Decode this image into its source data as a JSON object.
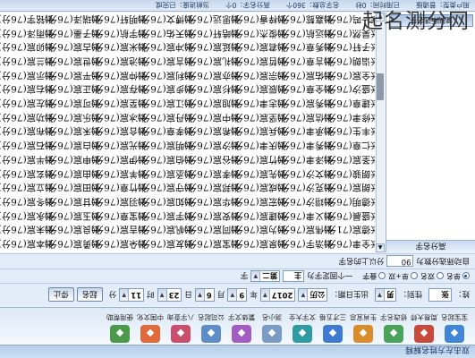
{
  "watermark": "起名测分网",
  "app": {
    "title": "双击左方姓名解释"
  },
  "toolbar": [
    {
      "label": "宝宝起名",
      "icon": "baby-icon",
      "color": "#3f86d6"
    },
    {
      "label": "周易大师",
      "icon": "bagua-icon",
      "color": "#c84a3a"
    },
    {
      "label": "修改名字",
      "icon": "edit-icon",
      "color": "#4aa35a"
    },
    {
      "label": "生肖宜忌",
      "icon": "zodiac-icon",
      "color": "#d98d2a"
    },
    {
      "label": "三才五格",
      "icon": "grid-icon",
      "color": "#3c7bd0"
    },
    {
      "label": "文字大全",
      "icon": "book-icon",
      "color": "#2f9ca3"
    },
    {
      "label": "测小名",
      "icon": "bird-icon",
      "color": "#7a9bc4"
    },
    {
      "label": "繁体文字",
      "icon": "text-icon",
      "color": "#a25cc2"
    },
    {
      "label": "公司起名",
      "icon": "building-icon",
      "color": "#5f8dc9"
    },
    {
      "label": "八字查询",
      "icon": "calendar-icon",
      "color": "#c94f6d"
    },
    {
      "label": "中国文化",
      "icon": "lantern-icon",
      "color": "#e06a3b"
    },
    {
      "label": "使用帮助",
      "icon": "help-icon",
      "color": "#4a9a4a"
    }
  ],
  "form": {
    "surname_label": "姓：",
    "surname_value": "张",
    "gender_label": "性别：",
    "gender_value": "男",
    "birth_label": "出生日期：",
    "calendar_value": "公历",
    "year_value": "2017",
    "year_unit": "年",
    "month_value": "9",
    "month_unit": "月",
    "day_value": "6",
    "day_unit": "日",
    "hour_value": "23",
    "hour_unit": "时",
    "minute_value": "11",
    "minute_unit": "分",
    "start_button": "起名",
    "stop_button": "停止"
  },
  "options": {
    "radios": [
      "单名",
      "双名",
      "单+双",
      "叠字"
    ],
    "selected_index": 0,
    "fixed_label": "一个固定字为",
    "fixed_value": "主",
    "position_value": "第二",
    "position_unit": "字",
    "score_label": "自动筛选分数为",
    "score_value": "90",
    "score_unit": "分以上的名字"
  },
  "sidebar": {
    "header": "高分名字",
    "footer_button": "复制所选名字"
  },
  "names": [
    [
      "张全聿(76分)",
      "张德宸(71分)",
      "张盛晨(76分)",
      "张德明(76分)",
      "张朗宸(76分)",
      "张朗骏(76分)",
      "张圣宸(76分)",
      "张仁章(76分)",
      "张丰生(76分)",
      "张修聿(76分)",
      "张建章(76分)",
      "张盛汐(76分)",
      "张全宸(76分)",
      "张诣朗(76分)",
      "张子轩(76分)",
      "张昊然(76分)",
      "张一鸣(76分)"
    ],
    [
      "张浩宇(76分)",
      "张伟宸(76分)",
      "张义聿(76分)",
      "张翊汐(76分)",
      "张克汐(76分)",
      "张文汐(76分)",
      "张泽聿(76分)",
      "张秀聿(76分)",
      "张承聿(76分)",
      "张信宸(76分)",
      "张秀宸(76分)",
      "张全章(76分)",
      "张佑宸(76分)",
      "张言章(76分)",
      "张秀章(76分)",
      "张远航(76分)",
      "张嘉懿(76分)"
    ],
    [
      "张泉宸(76分)",
      "张为宸(76分)",
      "张建宸(76分)",
      "张宏宸(76分)",
      "张成宸(76分)",
      "张先宸(76分)",
      "张竹宸(76分)",
      "张庆聿(76分)",
      "张兵宸(76分)",
      "张坚宸(76分)",
      "张志聿(76分)",
      "张辰宸(76分)",
      "张宗宸(76分)",
      "张哲宸(76分)",
      "张君宸(76分)",
      "张俊杰(76分)",
      "张梓睿(76分)"
    ],
    [
      "张宝宸(76分)",
      "张同宸(76分)",
      "张安宸(76分)",
      "张华宸(76分)",
      "张邦宸(76分)",
      "张孝宸(76分)",
      "张谷宸(76分)",
      "张汐宸(76分)",
      "张希宸(76分)",
      "张中宸(76分)",
      "张旭宸(76分)",
      "张杉宸(76分)",
      "张亦宸(76分)",
      "张礼宸(76分)",
      "张延宸(76分)",
      "张皓轩(76分)",
      "张思远(76分)"
    ],
    [
      "张友宸(76分)",
      "张帆宸(76分)",
      "张宇宸(76分)",
      "张如宸(76分)",
      "张守宸(76分)",
      "张丞宸(76分)",
      "张伯宸(76分)",
      "张明宸(76分)",
      "张孝章(76分)",
      "张丹宸(76分)",
      "张江宸(76分)",
      "张步宸(76分)",
      "张利宸(76分)",
      "张言宸(76分)",
      "张冲宸(76分)",
      "张天佑(76分)",
      "张博文(76分)"
    ],
    [
      "张朵宸(76分)",
      "张吉宸(76分)",
      "张宝章(76分)",
      "张羽宸(76分)",
      "张竹章(76分)",
      "张羊宸(76分)",
      "张伊宸(76分)",
      "张光宸(76分)",
      "张合宸(76分)",
      "张冰宸(76分)",
      "张至宸(76分)",
      "张存宸(76分)",
      "张仲宸(76分)",
      "张池宸(76分)",
      "张米宸(76分)",
      "张宇航(76分)",
      "张明轩(76分)"
    ],
    [
      "张勇宸(76分)",
      "张良宸(76分)",
      "张玉宸(76分)",
      "张甘宸(76分)",
      "张田宸(76分)",
      "张由宸(76分)",
      "张申宸(76分)",
      "张白宸(76分)",
      "张禾宸(76分)",
      "张乐宸(76分)",
      "张可宸(76分)",
      "张正宸(76分)",
      "张平宸(76分)",
      "张世宸(76分)",
      "张古宸(76分)",
      "张子墨(76分)",
      "张瑞泽(76分)"
    ],
    [
      "张本宸(76分)",
      "张未宸(76分)",
      "张永宸(76分)",
      "张冬宸(76分)",
      "张立宸(76分)",
      "张玄宸(76分)",
      "张半宸(76分)",
      "张石宸(76分)",
      "张布宸(76分)",
      "张功宸(76分)",
      "张左宸(76分)",
      "张右宸(76分)",
      "张示宸(76分)",
      "张兰宸(76分)",
      "张卯宸(76分)",
      "张雨泽(76分)",
      "张铭宇(76分)"
    ]
  ],
  "status": [
    "用户类型：普通版",
    "已用时间：0秒",
    "名字总数：360个",
    "高分名字：0个",
    "当前进度：已完成"
  ]
}
